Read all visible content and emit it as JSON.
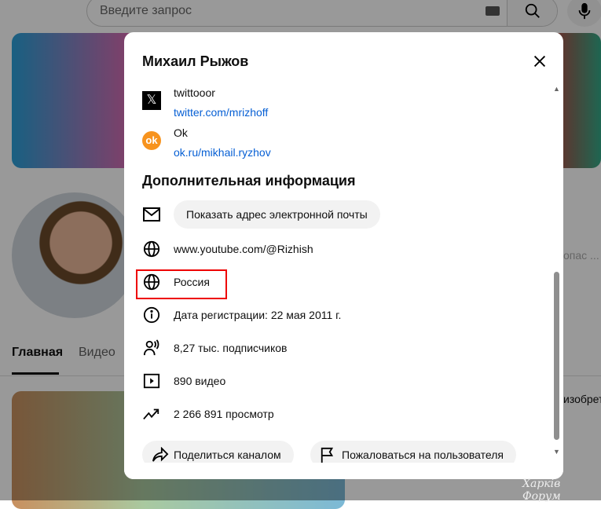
{
  "search": {
    "placeholder": "Введите запрос"
  },
  "tabs": [
    "Главная",
    "Видео"
  ],
  "side_text": [
    "опас ...",
    "изобрет"
  ],
  "modal": {
    "title": "Михаил Рыжов",
    "links": [
      {
        "name": "twittooor",
        "url": "twitter.com/mrizhoff"
      },
      {
        "name": "Ok",
        "url": "ok.ru/mikhail.ryzhov"
      }
    ],
    "section_title": "Дополнительная информация",
    "show_email": "Показать адрес электронной почты",
    "website": "www.youtube.com/@Rizhish",
    "country": "Россия",
    "joined": "Дата регистрации: 22 мая 2011 г.",
    "subscribers": "8,27 тыс. подписчиков",
    "videos": "890 видео",
    "views": "2 266 891 просмотр",
    "share": "Поделиться каналом",
    "report": "Пожаловаться на пользователя"
  },
  "watermark": "Харків Форум",
  "colors": {
    "link": "#065fd4",
    "highlight": "#e00000",
    "ok": "#f7931e"
  }
}
